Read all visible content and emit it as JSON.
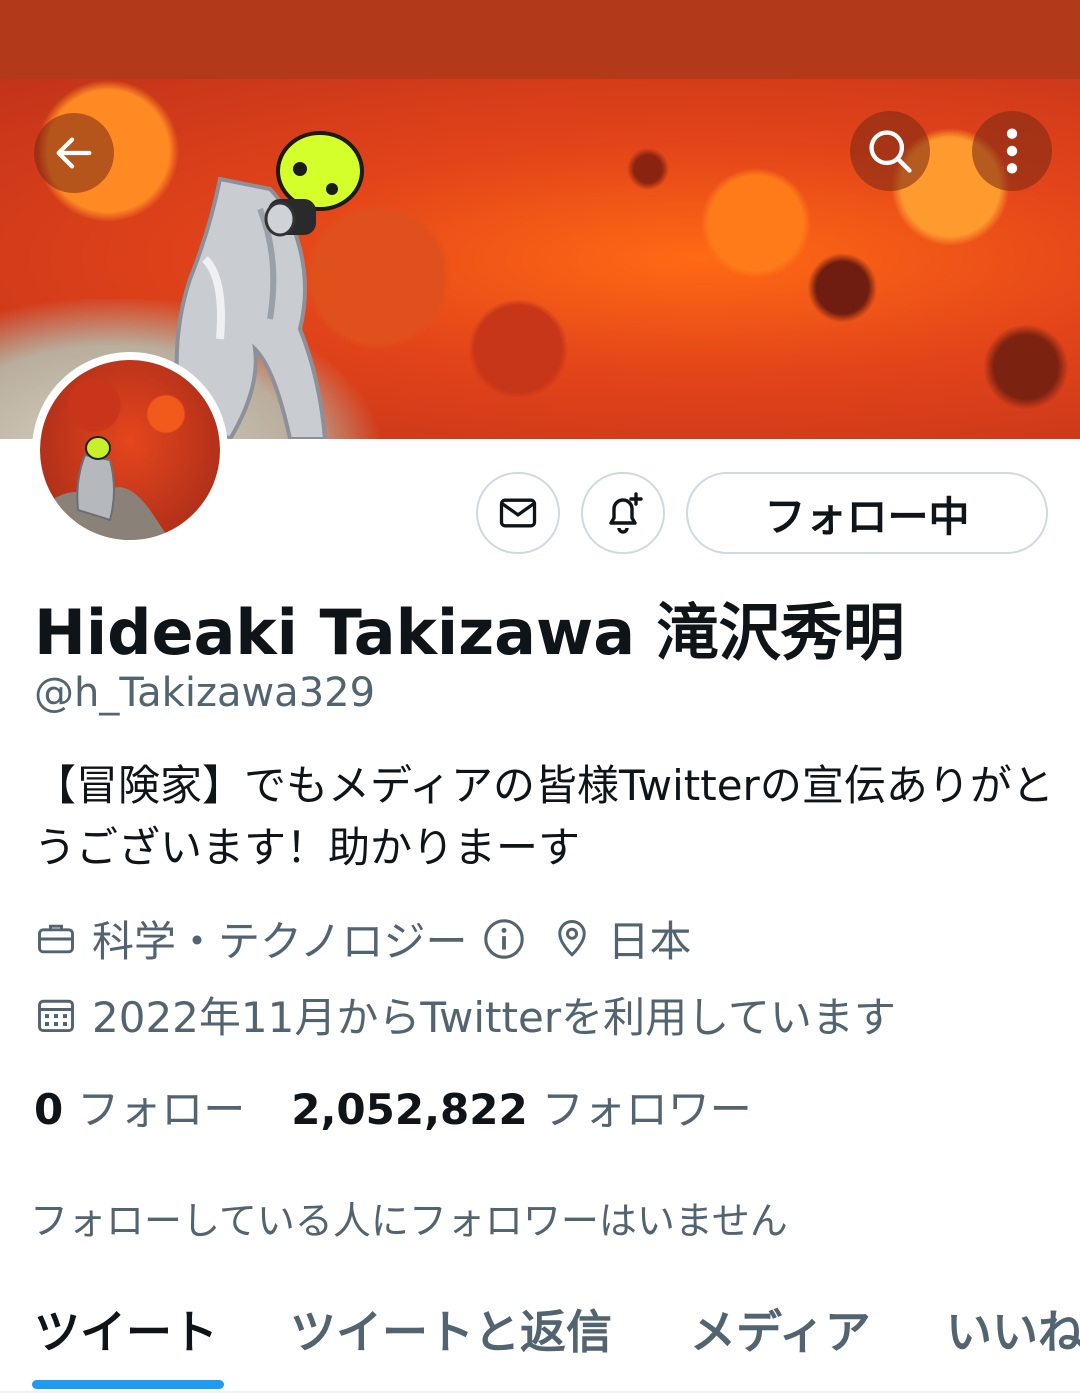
{
  "header": {
    "back_icon": "arrow-left-icon",
    "search_icon": "search-icon",
    "more_icon": "more-vertical-icon"
  },
  "profile": {
    "display_name": "Hideaki Takizawa 滝沢秀明",
    "handle": "@h_Takizawa329",
    "bio": "【冒険家】でもメディアの皆様Twitterの宣伝ありがとうございます！助かりまーす",
    "category": "科学・テクノロジー",
    "location": "日本",
    "joined": "2022年11月からTwitterを利用しています",
    "following_count": "0",
    "following_label": "フォロー",
    "followers_count": "2,052,822",
    "followers_label": "フォロワー",
    "followed_by_note": "フォローしている人にフォロワーはいません"
  },
  "actions": {
    "message_icon": "mail-icon",
    "notify_icon": "bell-plus-icon",
    "follow_label": "フォロー中"
  },
  "tabs": [
    {
      "label": "ツイート",
      "active": true
    },
    {
      "label": "ツイートと返信",
      "active": false
    },
    {
      "label": "メディア",
      "active": false
    },
    {
      "label": "いいね",
      "active": false
    }
  ],
  "colors": {
    "status_bar": "#b3391b",
    "accent": "#1d9bf0",
    "secondary_text": "#536471"
  }
}
